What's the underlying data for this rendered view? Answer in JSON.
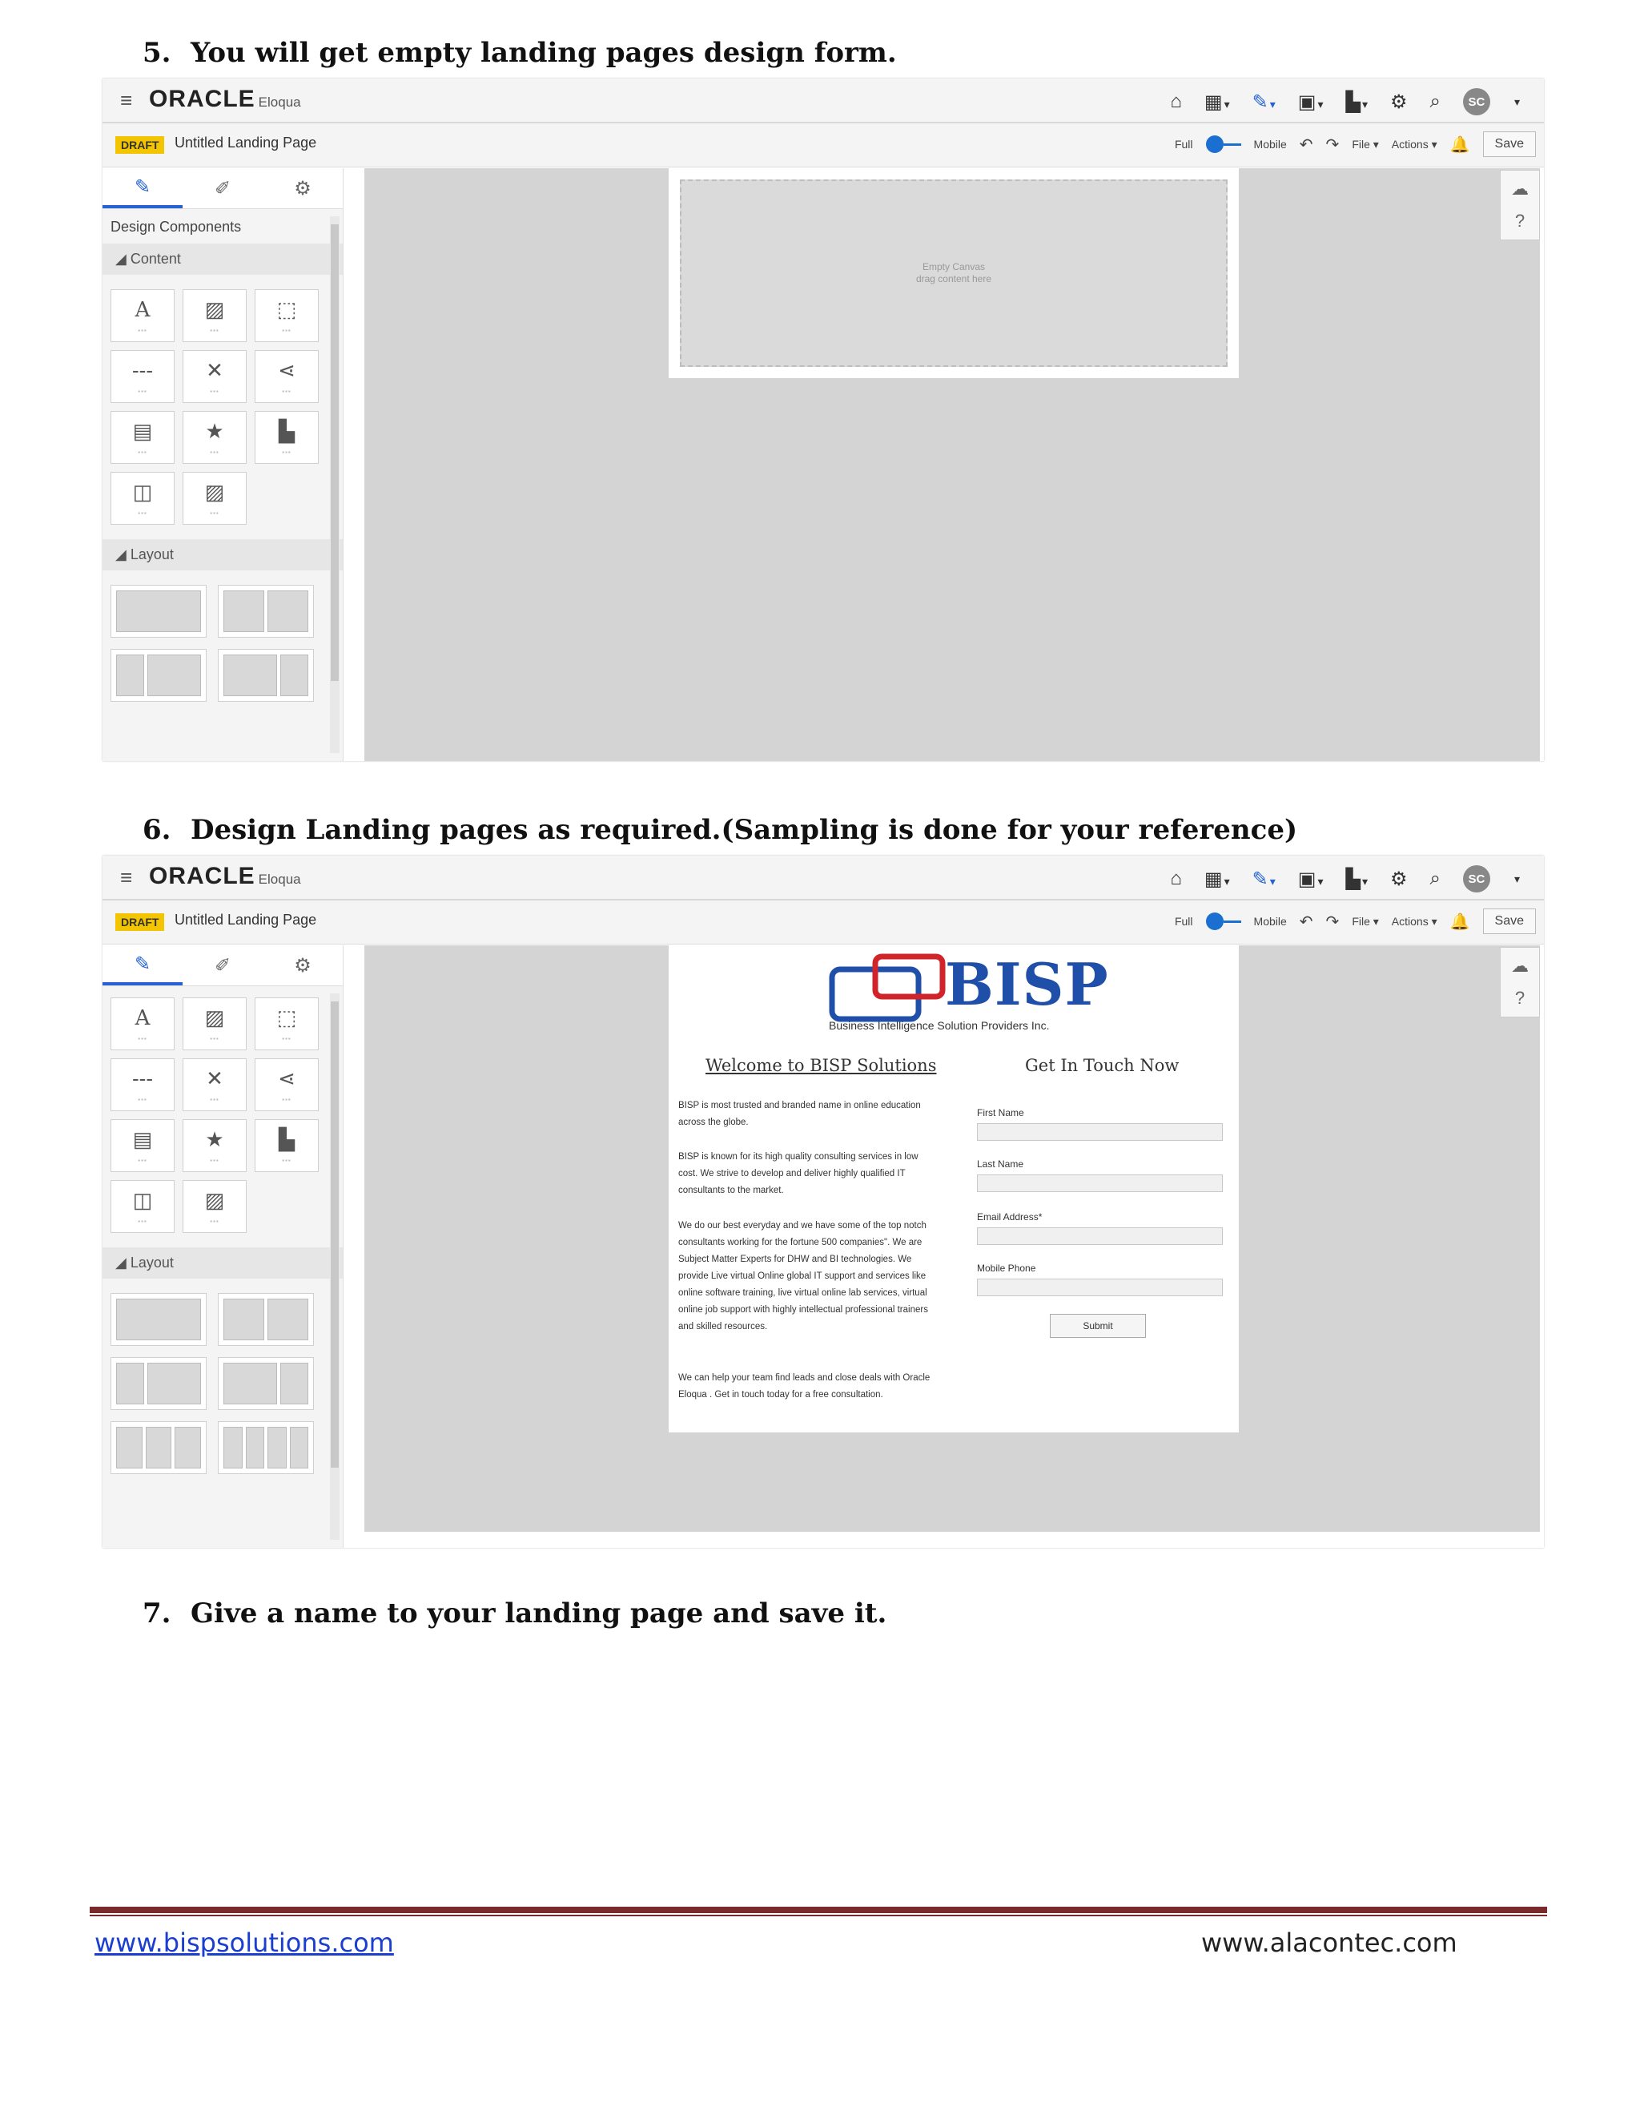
{
  "steps": [
    {
      "num": "5.",
      "text": "You will get empty landing pages design form."
    },
    {
      "num": "6.",
      "text": "Design Landing pages as required.(Sampling is done for your reference)"
    },
    {
      "num": "7.",
      "text": "Give a name to your landing page and save it."
    }
  ],
  "app": {
    "logo": "ORACLE",
    "product": "Eloqua",
    "avatar": "SC",
    "draft_badge": "DRAFT",
    "page_name": "Untitled Landing Page",
    "toggle_full": "Full",
    "toggle_mobile": "Mobile",
    "file_menu": "File ▾",
    "actions_menu": "Actions ▾",
    "save": "Save"
  },
  "sidebar": {
    "title": "Design Components",
    "content_section": "Content",
    "layout_section": "Layout"
  },
  "canvas": {
    "empty_line1": "Empty Canvas",
    "empty_line2": "drag content here"
  },
  "landing": {
    "brand": "BISP",
    "brand_sub": "Business Intelligence Solution Providers Inc.",
    "welcome": "Welcome to BISP Solutions",
    "get_in_touch": "Get In Touch Now",
    "paragraphs": [
      "BISP is most trusted and branded name in online education across the globe.",
      "BISP is known for its high quality consulting services in low cost. We strive to develop and deliver highly qualified IT consultants to the market.",
      "We do our best everyday and we have some of the top notch consultants working for the fortune 500 companies\". We are Subject Matter Experts for DHW and BI technologies. We provide Live virtual Online global IT support and services like online software training, live virtual online lab services, virtual online job support with highly intellectual professional trainers and skilled resources.",
      "We can help your team find leads and close deals with Oracle Eloqua . Get in touch today for a free consultation."
    ],
    "fields": [
      "First Name",
      "Last Name",
      "Email Address*",
      "Mobile Phone"
    ],
    "submit": "Submit"
  },
  "footer": {
    "left": "www.bispsolutions.com",
    "right": "www.alacontec.com"
  }
}
